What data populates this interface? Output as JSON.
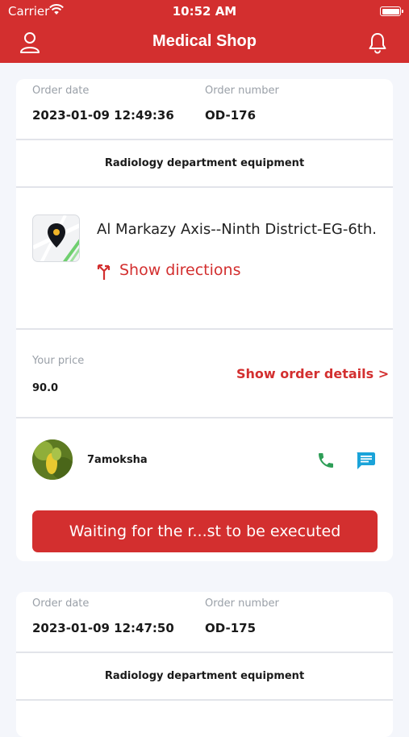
{
  "status_bar": {
    "carrier": "Carrier",
    "time": "10:52 AM"
  },
  "header": {
    "title": "Medical Shop"
  },
  "orders": [
    {
      "order_date_label": "Order date",
      "order_date": "2023-01-09 12:49:36",
      "order_number_label": "Order number",
      "order_number": "OD-176",
      "category": "Radiology department equipment",
      "address": "Al Markazy Axis--Ninth District-EG-6th...",
      "directions_label": "Show directions",
      "price_label": "Your price",
      "price": "90.0",
      "details_link": "Show order details >",
      "customer_name": "7amoksha",
      "status_button": "Waiting for the r...st to be executed"
    },
    {
      "order_date_label": "Order date",
      "order_date": "2023-01-09 12:47:50",
      "order_number_label": "Order number",
      "order_number": "OD-175",
      "category": "Radiology department equipment"
    }
  ],
  "colors": {
    "brand": "#d32f2f",
    "phone": "#2e9e57",
    "chat": "#1aa3d9"
  },
  "icons": {
    "profile": "person-icon",
    "notifications": "bell-icon",
    "map": "map-pin-icon",
    "directions": "directions-arrow-icon",
    "phone": "phone-icon",
    "chat": "chat-icon"
  }
}
